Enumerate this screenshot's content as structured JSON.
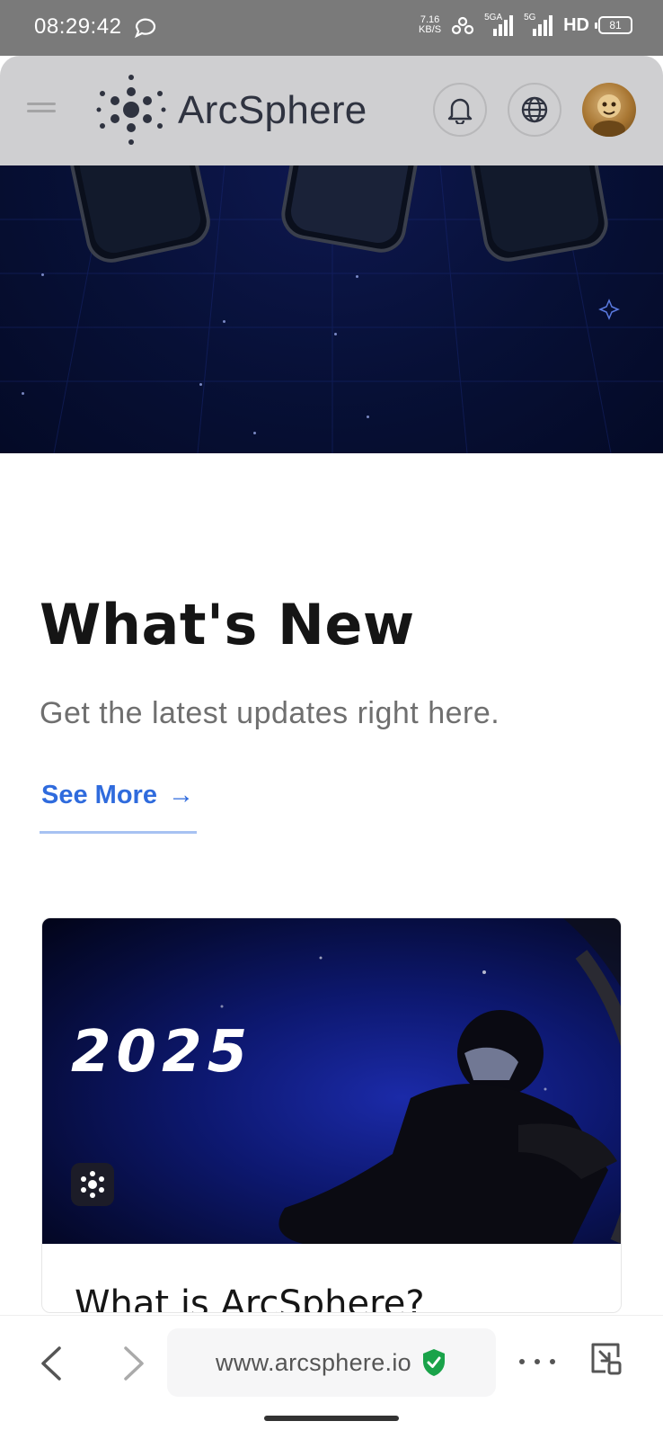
{
  "status_bar": {
    "time": "08:29:42",
    "net_speed_value": "7.16",
    "net_speed_unit": "KB/S",
    "signal_1": "5GA",
    "signal_2": "5G",
    "hd": "HD",
    "battery": "81"
  },
  "header": {
    "logo_text": "ArcSphere",
    "avatar_color": "#a87632"
  },
  "section": {
    "title": "What's New",
    "subtitle": "Get the latest updates right here.",
    "see_more": "See More",
    "see_more_arrow": "→",
    "accent": "#2f6bdd"
  },
  "card": {
    "year_text": "2025",
    "title": "What is ArcSphere?"
  },
  "browser": {
    "url": "www.arcsphere.io",
    "secure_color": "#1aa34a"
  }
}
